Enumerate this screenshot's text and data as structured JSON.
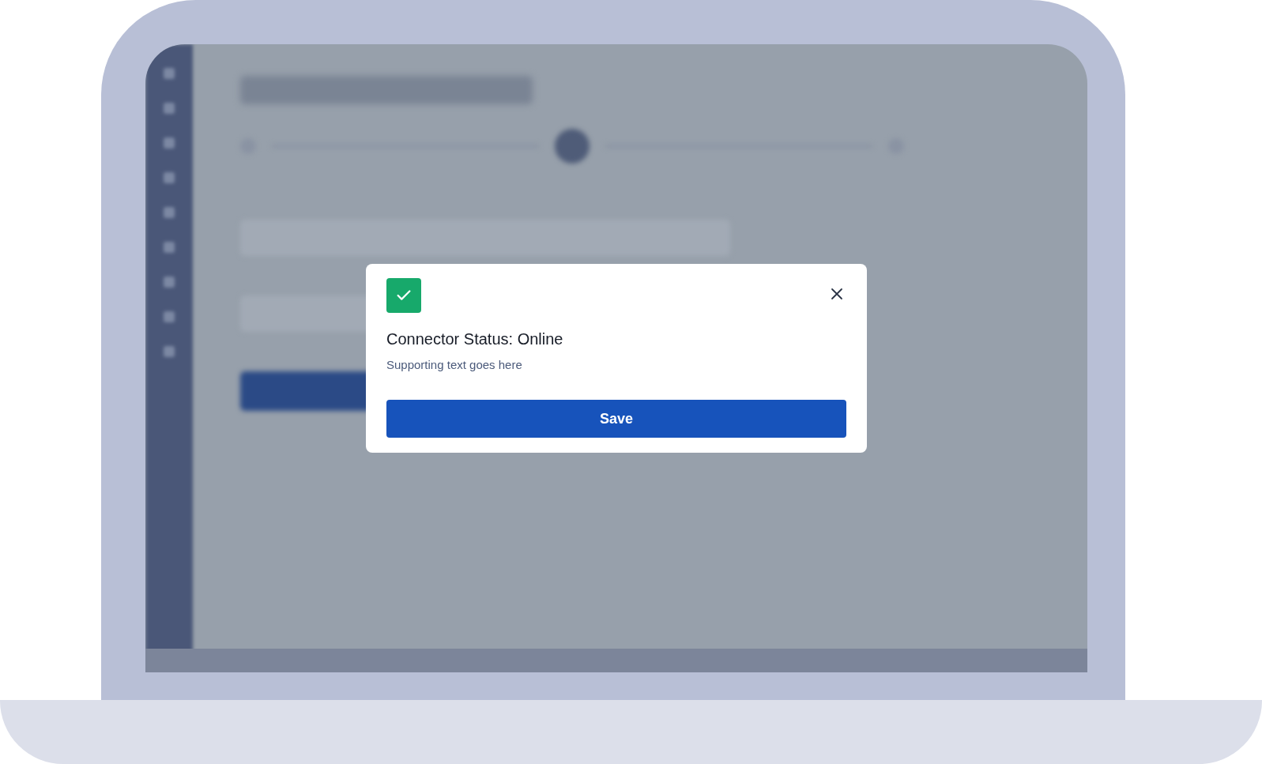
{
  "dialog": {
    "title": "Connector Status: Online",
    "text": "Supporting text goes here",
    "button": "Save"
  }
}
